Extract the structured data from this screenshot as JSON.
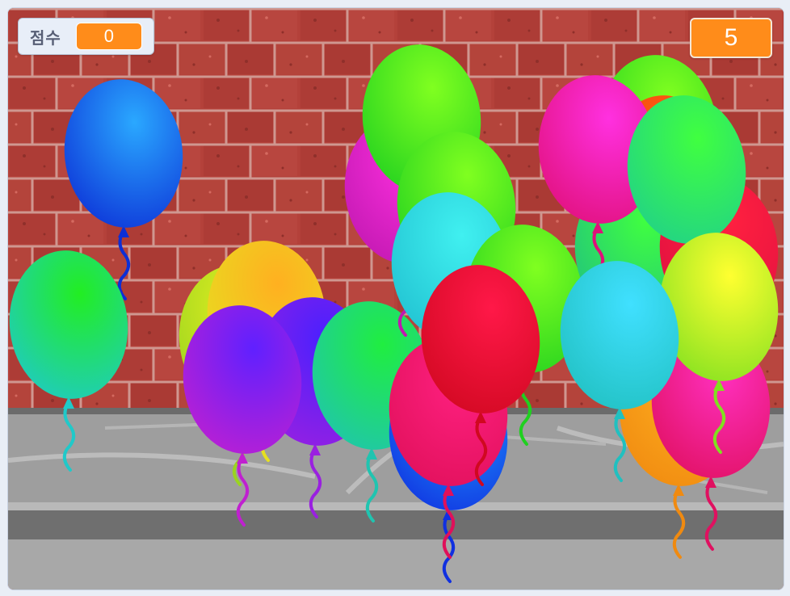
{
  "score": {
    "label": "점수",
    "value": "0"
  },
  "counter": {
    "value": "5"
  },
  "colors": {
    "brick": "#b4413a",
    "mortar": "#c98b84",
    "sidewalk": "#9d9d9d",
    "curb": "#6c6c6c",
    "road": "#a9a9a9",
    "monitor_accent": "#ff8c1a"
  },
  "balloons": [
    {
      "name": "balloon-blue-left",
      "c1": "#2aa8ff",
      "c2": "#0c2fd6"
    },
    {
      "name": "balloon-green-left",
      "c1": "#22ee22",
      "c2": "#20c9c9"
    },
    {
      "name": "balloon-chartreuse",
      "c1": "#e8f020",
      "c2": "#9ad420"
    },
    {
      "name": "balloon-yellow",
      "c1": "#ffb020",
      "c2": "#e6e020"
    },
    {
      "name": "balloon-indigo",
      "c1": "#4a20ff",
      "c2": "#9a20e0"
    },
    {
      "name": "balloon-purple",
      "c1": "#6020ff",
      "c2": "#c020d0"
    },
    {
      "name": "balloon-teal-center",
      "c1": "#20ee40",
      "c2": "#20c4b0"
    },
    {
      "name": "balloon-magenta-center",
      "c1": "#ff30e0",
      "c2": "#c018b0"
    },
    {
      "name": "balloon-green-top",
      "c1": "#80ff20",
      "c2": "#20d020"
    },
    {
      "name": "balloon-green-center",
      "c1": "#80ff20",
      "c2": "#20d020"
    },
    {
      "name": "balloon-cyan-center",
      "c1": "#40f0f0",
      "c2": "#20c0d0"
    },
    {
      "name": "balloon-lime-center",
      "c1": "#80ff20",
      "c2": "#20d020"
    },
    {
      "name": "balloon-blue-low",
      "c1": "#20a0ff",
      "c2": "#1030e0"
    },
    {
      "name": "balloon-pink-low",
      "c1": "#ff2080",
      "c2": "#e0105a"
    },
    {
      "name": "balloon-red-center",
      "c1": "#ff1848",
      "c2": "#d00820"
    },
    {
      "name": "balloon-green-right-top",
      "c1": "#80ff20",
      "c2": "#20d020"
    },
    {
      "name": "balloon-orange-right",
      "c1": "#ff6010",
      "c2": "#f04010"
    },
    {
      "name": "balloon-green-right-back",
      "c1": "#40ff40",
      "c2": "#20c080"
    },
    {
      "name": "balloon-red-right-back",
      "c1": "#ff2040",
      "c2": "#e01040"
    },
    {
      "name": "balloon-magenta-right",
      "c1": "#ff30e0",
      "c2": "#e0107a"
    },
    {
      "name": "balloon-green-right",
      "c1": "#40ff40",
      "c2": "#20d08a"
    },
    {
      "name": "balloon-orange-low-right",
      "c1": "#ffb020",
      "c2": "#f08a10"
    },
    {
      "name": "balloon-pink-right",
      "c1": "#ff30c0",
      "c2": "#e01060"
    },
    {
      "name": "balloon-yellow-right",
      "c1": "#ffff30",
      "c2": "#80e020"
    },
    {
      "name": "balloon-cyan-right",
      "c1": "#40e0ff",
      "c2": "#20c0c0"
    }
  ]
}
